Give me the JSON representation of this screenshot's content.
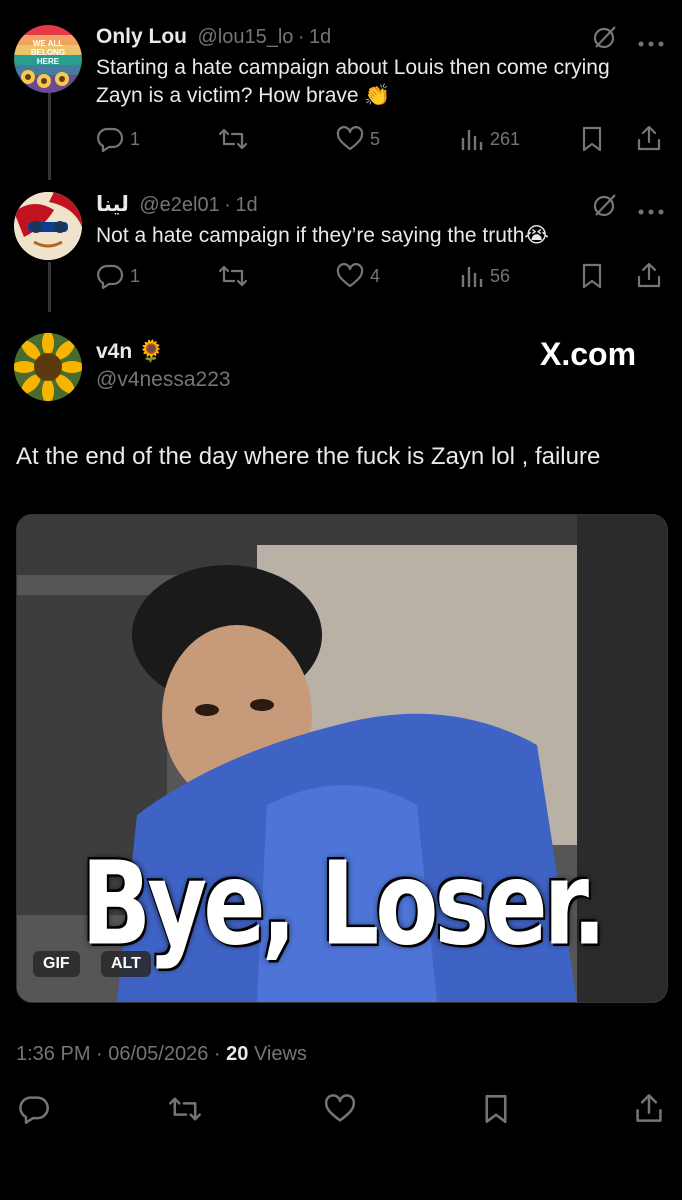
{
  "replies": [
    {
      "name": "Only Lou",
      "handle": "@lou15_lo",
      "time": "1d",
      "text": "Starting a hate campaign about Louis then come crying Zayn is a victim? How brave 👏",
      "avatar_text": "WE ALL BELONG HERE",
      "counts": {
        "replies": "1",
        "reposts": "",
        "likes": "5",
        "views": "261"
      }
    },
    {
      "name": "لينا",
      "handle": "@e2el01",
      "time": "1d",
      "text": "Not a hate campaign if they’re saying the truth😭",
      "counts": {
        "replies": "1",
        "reposts": "",
        "likes": "4",
        "views": "56"
      }
    }
  ],
  "main": {
    "name": "v4n 🌻",
    "handle": "@v4nessa223",
    "brand": "X.com",
    "text": "At the end of the day where the fuck is Zayn lol , failure",
    "media": {
      "caption": "Bye, Loser.",
      "gif_badge": "GIF",
      "alt_badge": "ALT"
    },
    "meta": {
      "time": "1:36 PM · 06/05/2026 · ",
      "views_count": "20",
      "views_label": " Views"
    }
  },
  "colors": {
    "bg": "#000000",
    "text": "#e7e9ea",
    "muted": "#71767b",
    "line": "#333639"
  }
}
